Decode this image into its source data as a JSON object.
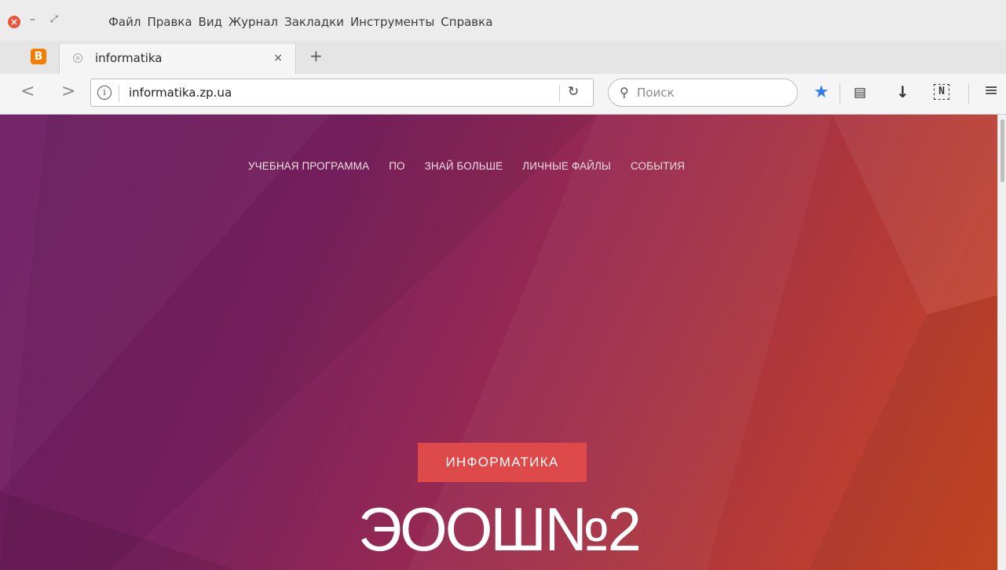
{
  "window": {
    "menu": [
      "Файл",
      "Правка",
      "Вид",
      "Журнал",
      "Закладки",
      "Инструменты",
      "Справка"
    ]
  },
  "tabs": {
    "active_title": "informatika",
    "close_glyph": "×",
    "new_tab_glyph": "+"
  },
  "navbar": {
    "url": "informatika.zp.ua",
    "search_placeholder": "Поиск",
    "extension_label": "N"
  },
  "page": {
    "nav": [
      "УЧЕБНАЯ ПРОГРАММА",
      "ПО",
      "ЗНАЙ БОЛЬШЕ",
      "ЛИЧНЫЕ ФАЙЛЫ",
      "СОБЫТИЯ"
    ],
    "badge": "ИНФОРМАТИКА",
    "title": "ЭООШ№2"
  },
  "colors": {
    "accent_badge": "#de4a4a",
    "bookmark_star": "#2e7ee6",
    "pinned_tab": "#f57d00",
    "close_button": "#e8553a"
  },
  "icons": [
    "close-window-icon",
    "minimize-icon",
    "maximize-icon",
    "blogger-icon",
    "site-favicon-icon",
    "back-arrow-icon",
    "forward-arrow-icon",
    "info-icon",
    "reload-icon",
    "search-icon",
    "bookmark-star-icon",
    "reader-icon",
    "download-icon",
    "extension-icon",
    "hamburger-menu-icon"
  ]
}
